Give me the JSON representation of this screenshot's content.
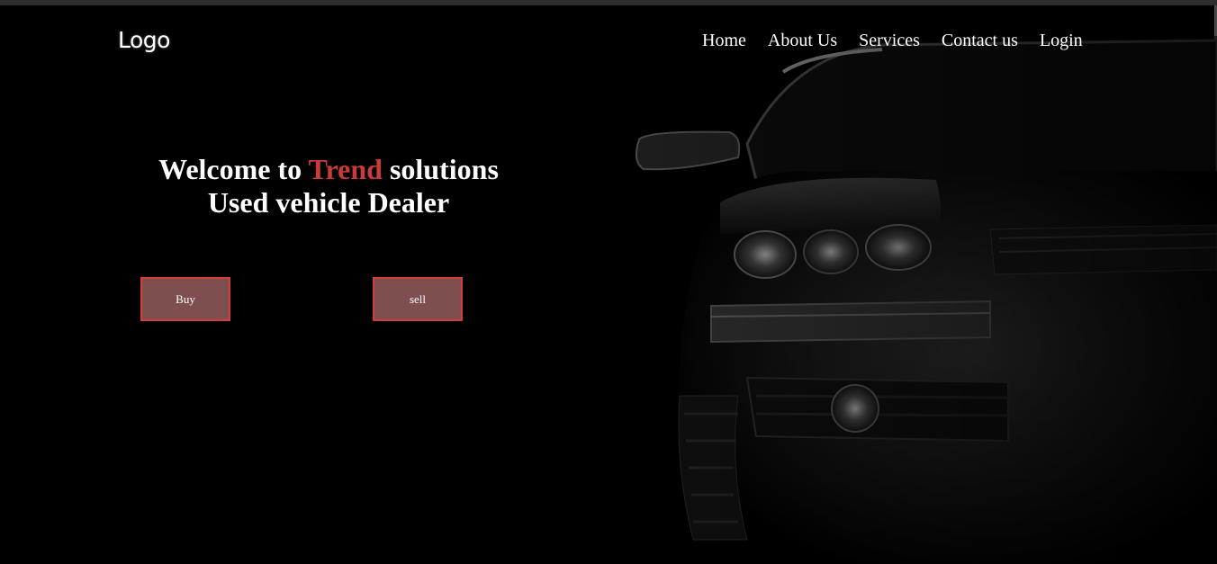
{
  "logo": {
    "text": "Logo"
  },
  "nav": {
    "items": [
      {
        "label": "Home"
      },
      {
        "label": "About Us"
      },
      {
        "label": "Services"
      },
      {
        "label": "Contact us"
      },
      {
        "label": "Login"
      }
    ]
  },
  "hero": {
    "line1_prefix": "Welcome to ",
    "line1_accent": "Trend",
    "line1_suffix": " solutions",
    "line2": "Used vehicle Dealer"
  },
  "buttons": {
    "buy": "Buy",
    "sell": "sell"
  },
  "colors": {
    "accent": "#c93b3b",
    "button_bg": "#7f4f4f",
    "button_border": "#d63c3c",
    "background": "#000000"
  }
}
